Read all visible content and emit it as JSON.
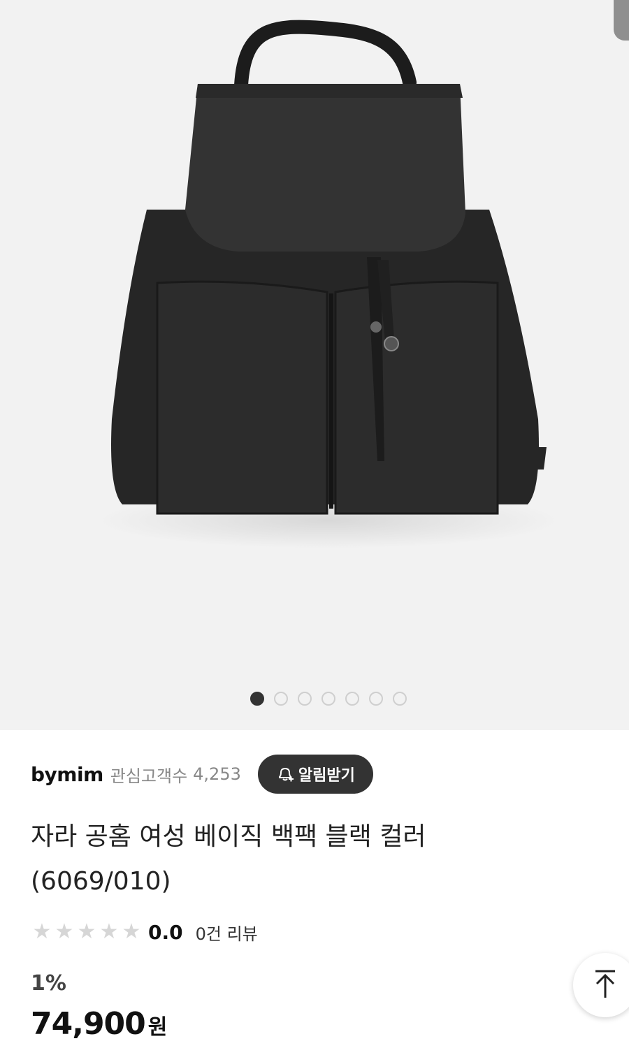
{
  "gallery": {
    "image_alt": "black leather backpack",
    "total_images": 7,
    "current_index": 1
  },
  "shop": {
    "name": "bymim",
    "follower_label": "관심고객수",
    "follower_count": "4,253",
    "notify_label": "알림받기"
  },
  "product": {
    "title_line1": "자라 공홈 여성 베이직 백팩 블랙 컬러",
    "title_line2": "(6069/010)",
    "rating": "0.0",
    "review_label": "0건 리뷰",
    "discount": "1%",
    "price": "74,900",
    "currency": "원"
  },
  "icons": {
    "notify": "bell-plus-icon",
    "scroll_top": "arrow-up-icon",
    "star": "star-icon"
  },
  "colors": {
    "hero_bg": "#f2f2f2",
    "button_dark": "#333333",
    "star_inactive": "#d6d6d6"
  }
}
